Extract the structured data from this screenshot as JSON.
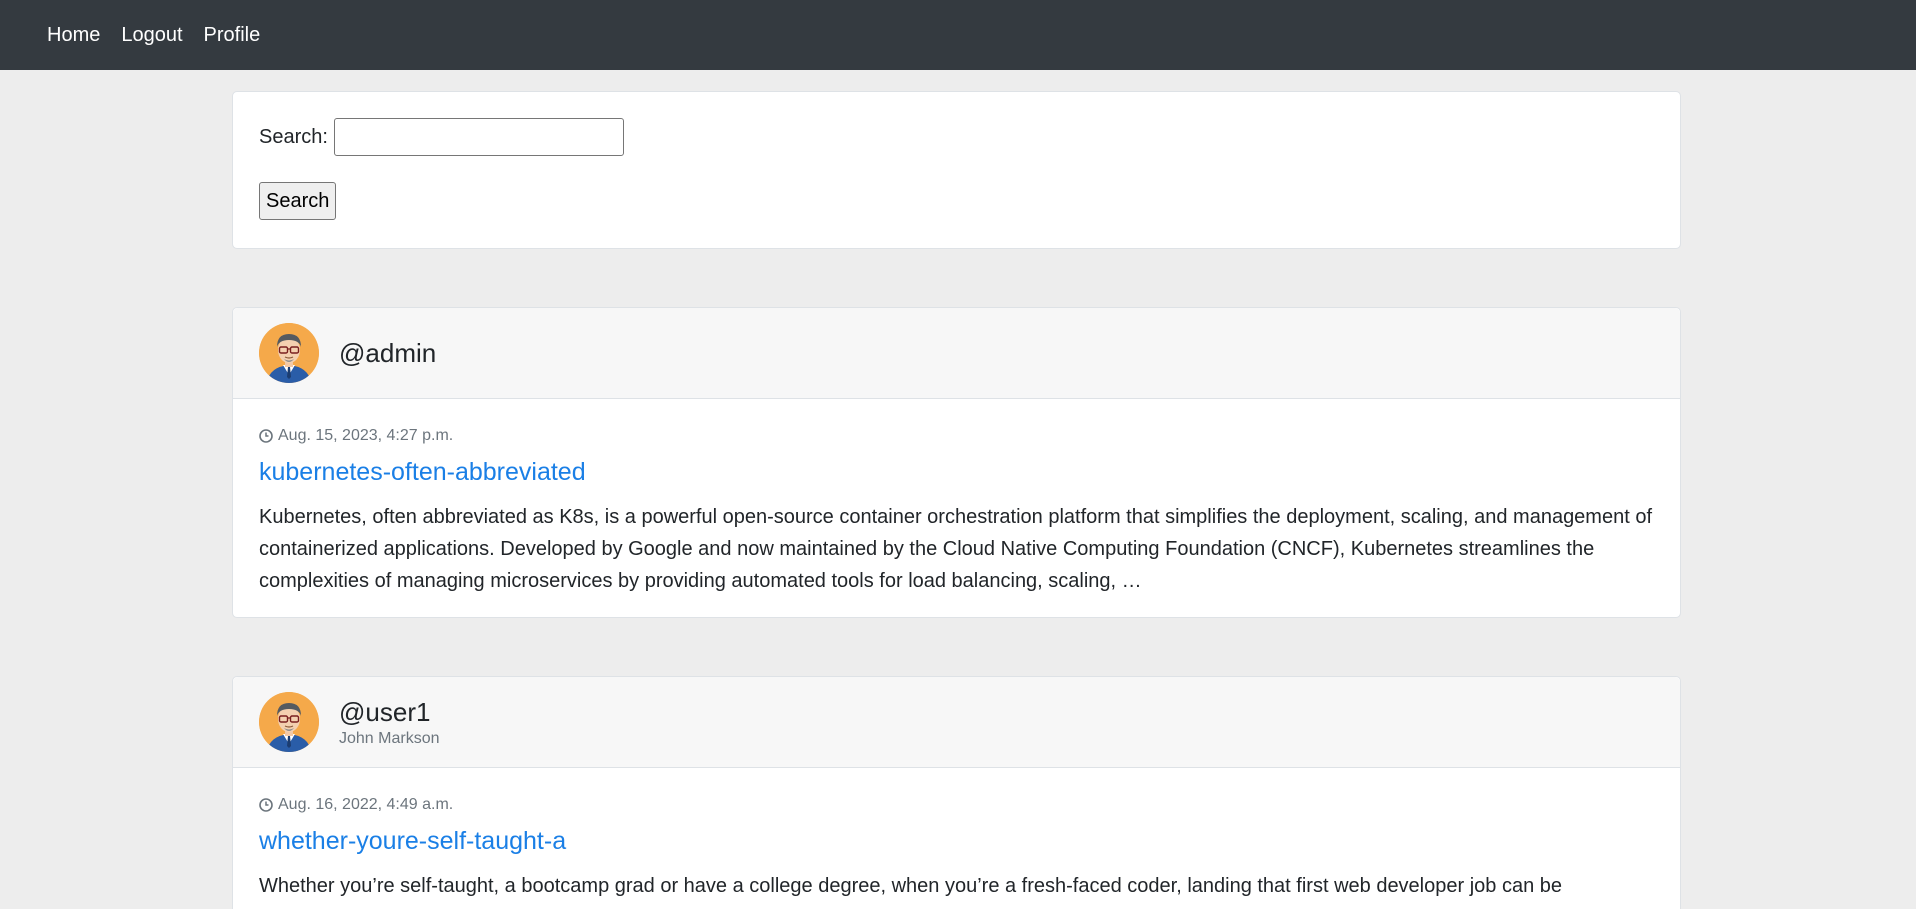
{
  "nav": {
    "home": "Home",
    "logout": "Logout",
    "profile": "Profile"
  },
  "search": {
    "label": "Search:",
    "value": "",
    "button": "Search"
  },
  "posts": [
    {
      "username": "@admin",
      "fullname": "",
      "date": "Aug. 15, 2023, 4:27 p.m.",
      "title": "kubernetes-often-abbreviated",
      "excerpt": "Kubernetes, often abbreviated as K8s, is a powerful open-source container orchestration platform that simplifies the deployment, scaling, and management of containerized applications. Developed by Google and now maintained by the Cloud Native Computing Foundation (CNCF), Kubernetes streamlines the complexities of managing microservices by providing automated tools for load balancing, scaling, …"
    },
    {
      "username": "@user1",
      "fullname": "John Markson",
      "date": "Aug. 16, 2022, 4:49 a.m.",
      "title": "whether-youre-self-taught-a",
      "excerpt": "Whether you’re self-taught, a bootcamp grad or have a college degree, when you’re a fresh-faced coder, landing that first web developer job can be"
    }
  ],
  "colors": {
    "navbar": "#343a40",
    "link": "#1a7fe6",
    "muted": "#6c757d",
    "avatar_bg": "#f5a94a"
  }
}
